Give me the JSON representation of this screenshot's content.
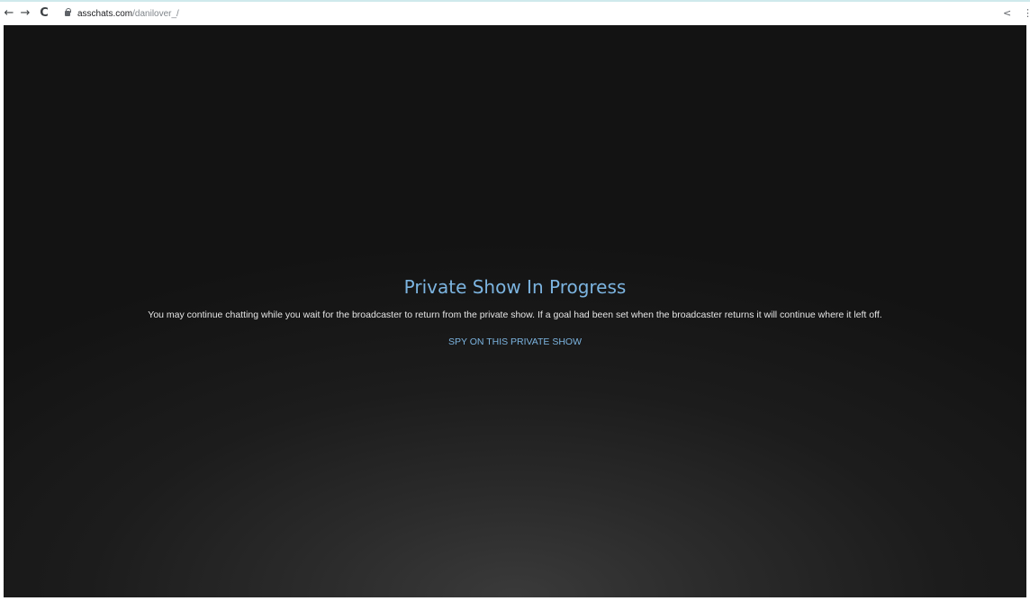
{
  "browser": {
    "back_icon": "←",
    "forward_icon": "→",
    "reload_icon": "C",
    "url_host": "asschats.com",
    "url_path": "/danilover_/",
    "share_icon": "<",
    "menu_icon": "⋮"
  },
  "private_show": {
    "title": "Private Show In Progress",
    "message": "You may continue chatting while you wait for the broadcaster to return from the private show. If a goal had been set when the broadcaster returns it will continue where it left off.",
    "spy_link": "SPY ON THIS PRIVATE SHOW"
  },
  "colors": {
    "accent": "#7cb4e0",
    "background": "#131313",
    "text": "#e6e6e6"
  }
}
